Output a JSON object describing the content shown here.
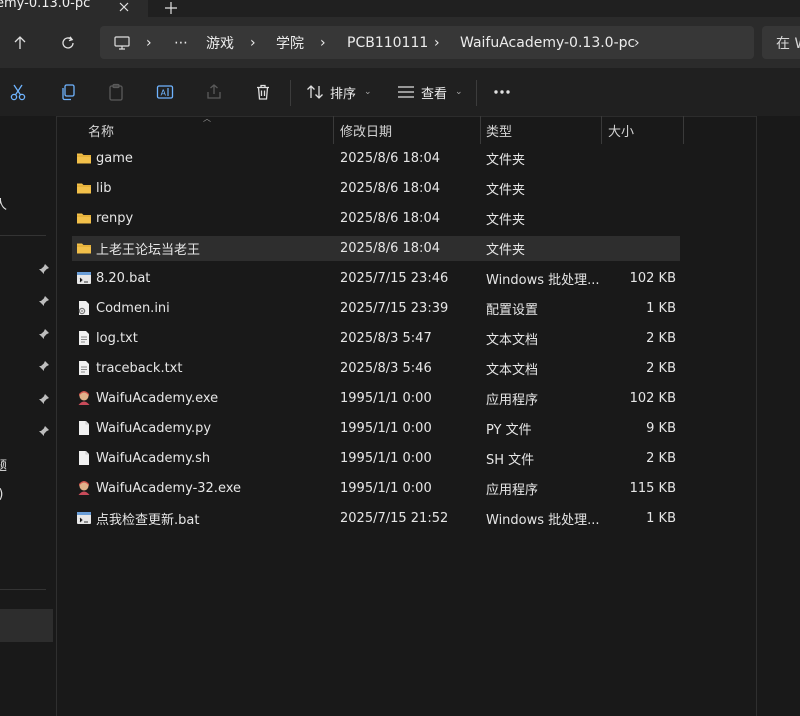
{
  "window": {
    "tab_title": "emy-0.13.0-pc"
  },
  "address_bar": {
    "breadcrumbs": [
      "游戏",
      "学院",
      "PCB110111",
      "WaifuAcademy-0.13.0-pc"
    ],
    "search_placeholder": "在 W"
  },
  "command_bar": {
    "sort_label": "排序",
    "view_label": "查看"
  },
  "left_pane": {
    "items": [
      "人",
      "题",
      ":)"
    ]
  },
  "columns": {
    "name": "名称",
    "date": "修改日期",
    "type": "类型",
    "size": "大小"
  },
  "files": [
    {
      "name": "game",
      "date": "2025/8/6 18:04",
      "type": "文件夹",
      "size": "",
      "icon": "folder-icon"
    },
    {
      "name": "lib",
      "date": "2025/8/6 18:04",
      "type": "文件夹",
      "size": "",
      "icon": "folder-icon"
    },
    {
      "name": "renpy",
      "date": "2025/8/6 18:04",
      "type": "文件夹",
      "size": "",
      "icon": "folder-icon"
    },
    {
      "name": "上老王论坛当老王",
      "date": "2025/8/6 18:04",
      "type": "文件夹",
      "size": "",
      "icon": "folder-icon",
      "selected": true
    },
    {
      "name": "8.20.bat",
      "date": "2025/7/15 23:46",
      "type": "Windows 批处理...",
      "size": "102 KB",
      "icon": "batch-file-icon"
    },
    {
      "name": "Codmen.ini",
      "date": "2025/7/15 23:39",
      "type": "配置设置",
      "size": "1 KB",
      "icon": "settings-file-icon"
    },
    {
      "name": "log.txt",
      "date": "2025/8/3 5:47",
      "type": "文本文档",
      "size": "2 KB",
      "icon": "text-file-icon"
    },
    {
      "name": "traceback.txt",
      "date": "2025/8/3 5:46",
      "type": "文本文档",
      "size": "2 KB",
      "icon": "text-file-icon"
    },
    {
      "name": "WaifuAcademy.exe",
      "date": "1995/1/1 0:00",
      "type": "应用程序",
      "size": "102 KB",
      "icon": "app-icon"
    },
    {
      "name": "WaifuAcademy.py",
      "date": "1995/1/1 0:00",
      "type": "PY 文件",
      "size": "9 KB",
      "icon": "file-icon"
    },
    {
      "name": "WaifuAcademy.sh",
      "date": "1995/1/1 0:00",
      "type": "SH 文件",
      "size": "2 KB",
      "icon": "file-icon"
    },
    {
      "name": "WaifuAcademy-32.exe",
      "date": "1995/1/1 0:00",
      "type": "应用程序",
      "size": "115 KB",
      "icon": "app-icon"
    },
    {
      "name": "点我检查更新.bat",
      "date": "2025/7/15 21:52",
      "type": "Windows 批处理...",
      "size": "1 KB",
      "icon": "batch-file-icon"
    }
  ],
  "colors": {
    "background": "#191919",
    "folder": "#f2c04a",
    "selected_row": "#2e2e2e"
  }
}
